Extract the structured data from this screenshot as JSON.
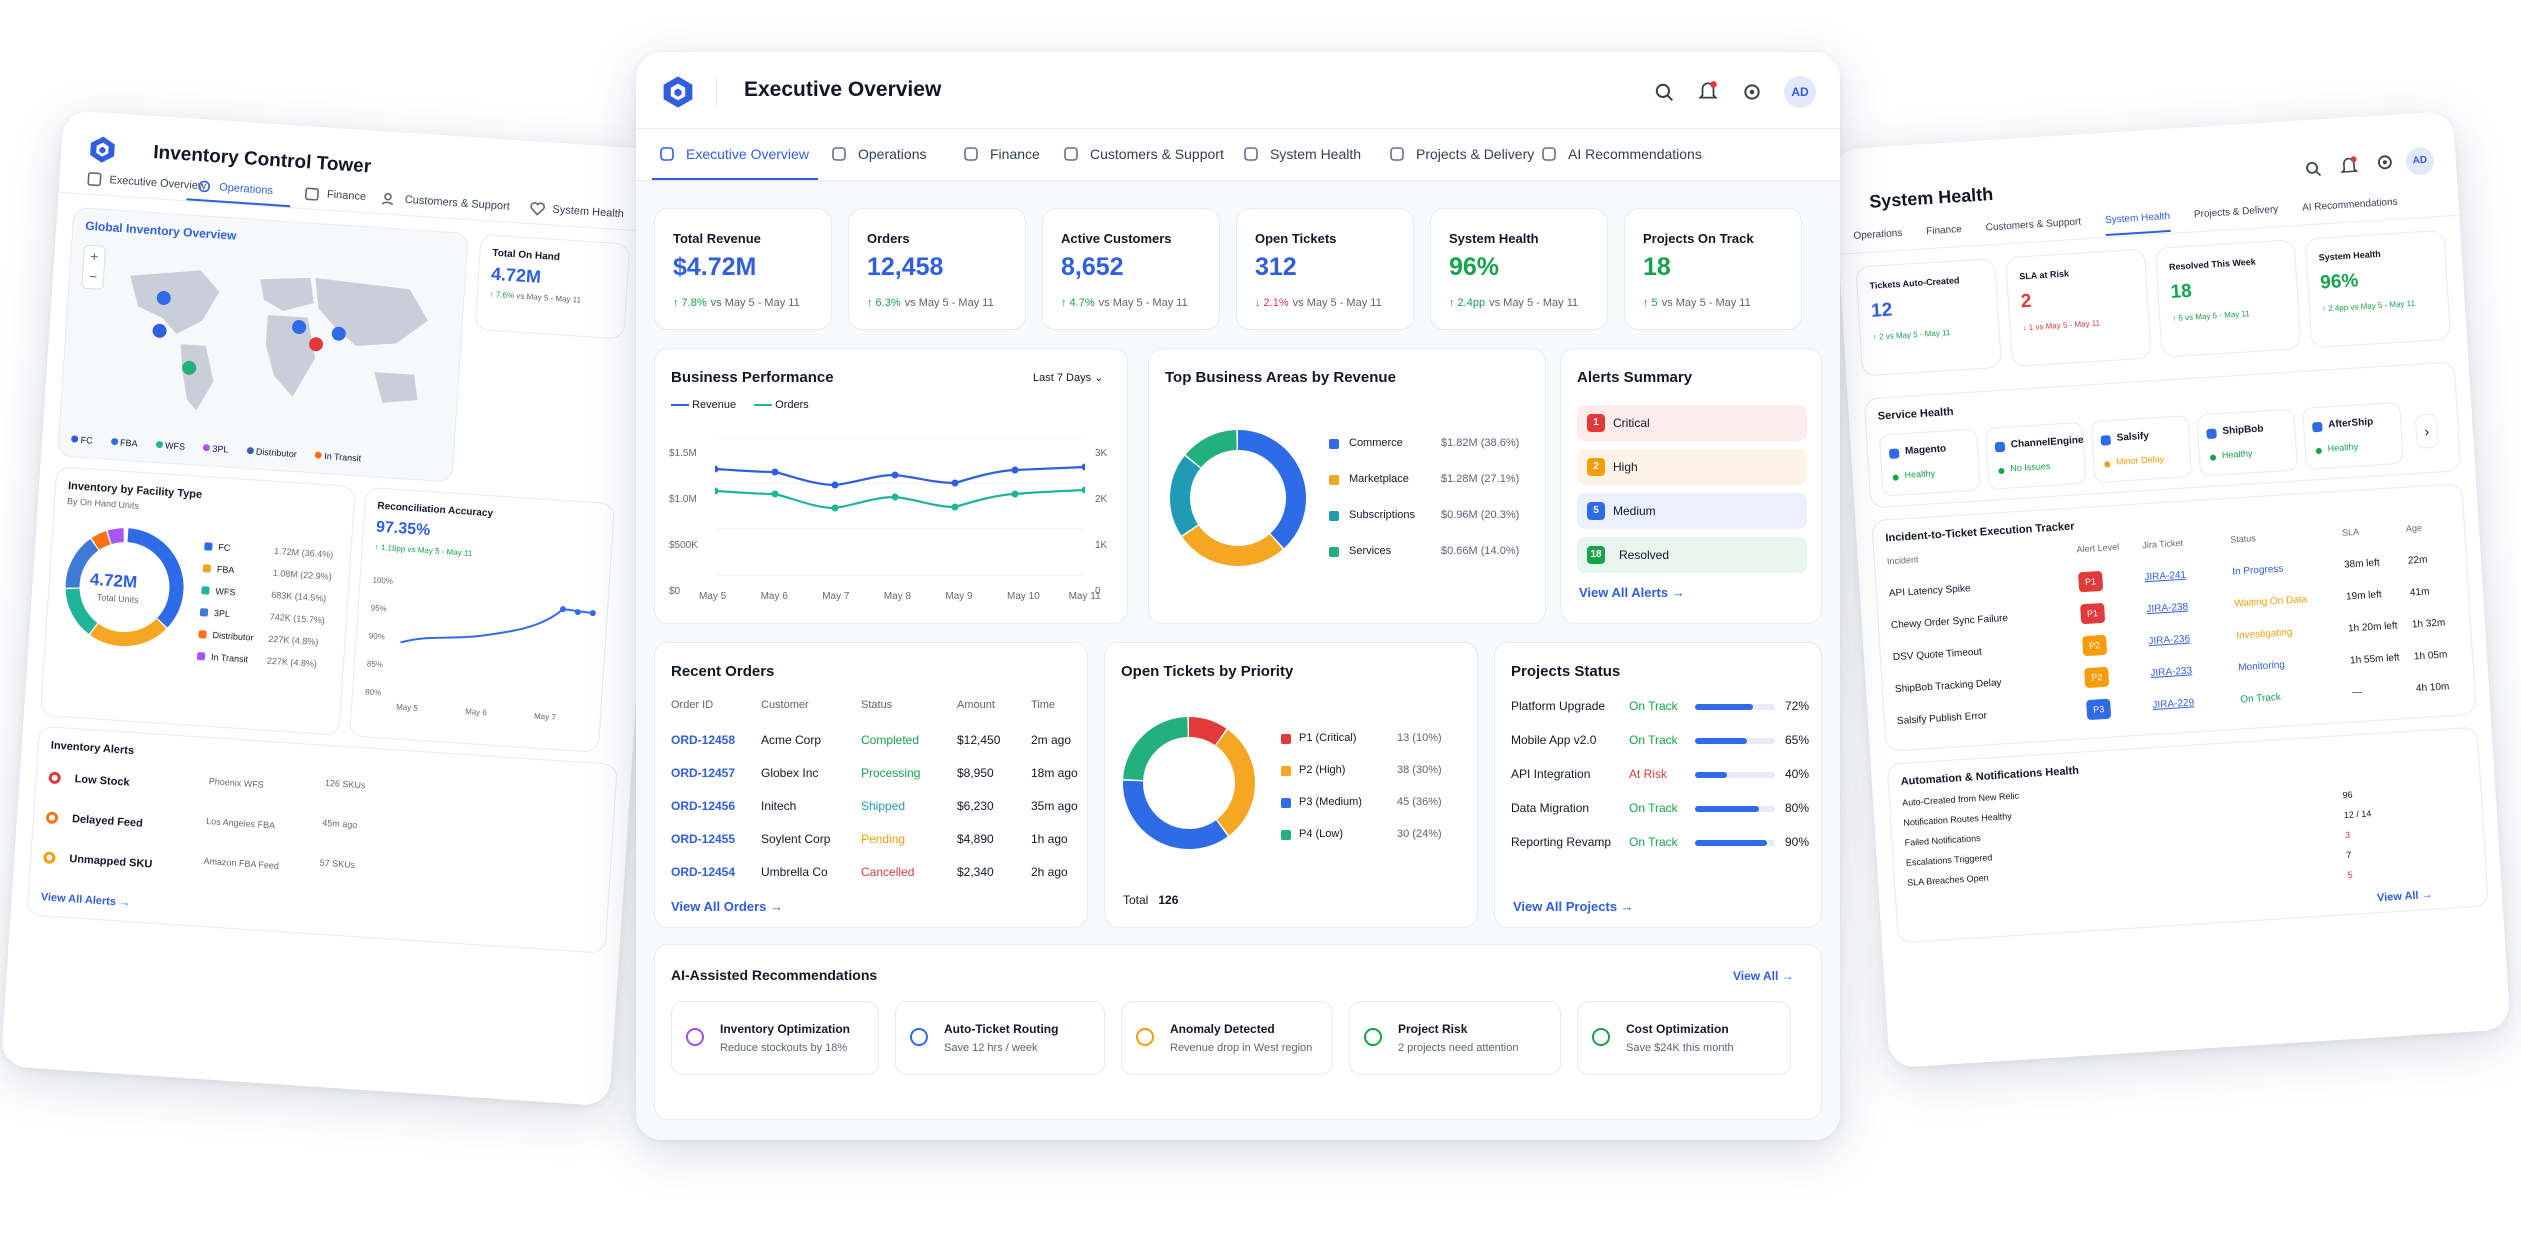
{
  "left": {
    "title": "Inventory Control Tower",
    "tabs": [
      "Executive Overview",
      "Operations",
      "Finance",
      "Customers & Support",
      "System Health"
    ],
    "map": {
      "title": "Global Inventory Overview",
      "zoom_in": "+",
      "zoom_out": "−",
      "legend": [
        "FC",
        "FBA",
        "WFS",
        "3PL",
        "Distributor",
        "In Transit"
      ]
    },
    "on_hand": {
      "label": "Total On Hand",
      "value": "4.72M",
      "delta": "↑ 7.6%",
      "period": "vs May 5 - May 11"
    },
    "facility": {
      "title": "Inventory by Facility Type",
      "subtitle": "By On Hand Units",
      "center_value": "4.72M",
      "center_label": "Total Units",
      "rows": [
        {
          "name": "FC",
          "value": "1.72M (36.4%)",
          "color": "#2f6be6"
        },
        {
          "name": "FBA",
          "value": "1.08M (22.9%)",
          "color": "#f5a623"
        },
        {
          "name": "WFS",
          "value": "683K (14.5%)",
          "color": "#1fb59a"
        },
        {
          "name": "3PL",
          "value": "742K (15.7%)",
          "color": "#3f7bd6"
        },
        {
          "name": "Distributor",
          "value": "227K (4.8%)",
          "color": "#f97316"
        },
        {
          "name": "In Transit",
          "value": "227K (4.8%)",
          "color": "#a855f7"
        }
      ]
    },
    "recon": {
      "title": "Reconciliation Accuracy",
      "value": "97.35%",
      "delta": "↑ 1.18pp vs May 5 - May 11",
      "yticks": [
        "100%",
        "95%",
        "90%",
        "85%",
        "80%"
      ],
      "xticks": [
        "May 5",
        "May 6",
        "May 7"
      ]
    },
    "alerts": {
      "title": "Inventory Alerts",
      "link": "View All Alerts →",
      "rows": [
        {
          "name": "Low Stock",
          "where": "Phoenix WFS",
          "meta": "126 SKUs"
        },
        {
          "name": "Delayed Feed",
          "where": "Los Angeles FBA",
          "meta": "45m ago"
        },
        {
          "name": "Unmapped SKU",
          "where": "Amazon FBA Feed",
          "meta": "57 SKUs"
        }
      ]
    }
  },
  "main": {
    "title": "Executive Overview",
    "avatar": "AD",
    "tabs": [
      "Executive Overview",
      "Operations",
      "Finance",
      "Customers & Support",
      "System Health",
      "Projects & Delivery",
      "AI Recommendations"
    ],
    "kpis": [
      {
        "label": "Total Revenue",
        "value": "$4.72M",
        "delta": "↑ 7.8%",
        "period": "vs May 5 - May 11",
        "dir": "up",
        "color": "blue"
      },
      {
        "label": "Orders",
        "value": "12,458",
        "delta": "↑ 6.3%",
        "period": "vs May 5 - May 11",
        "dir": "up",
        "color": "blue"
      },
      {
        "label": "Active Customers",
        "value": "8,652",
        "delta": "↑ 4.7%",
        "period": "vs May 5 - May 11",
        "dir": "up",
        "color": "blue"
      },
      {
        "label": "Open Tickets",
        "value": "312",
        "delta": "↓ 2.1%",
        "period": "vs May 5 - May 11",
        "dir": "down",
        "color": "blue"
      },
      {
        "label": "System Health",
        "value": "96%",
        "delta": "↑ 2.4pp",
        "period": "vs May 5 - May 11",
        "dir": "up",
        "color": "green"
      },
      {
        "label": "Projects On Track",
        "value": "18",
        "delta": "↑ 5",
        "period": "vs May 5 - May 11",
        "dir": "up",
        "color": "green"
      }
    ],
    "perf": {
      "title": "Business Performance",
      "range": "Last 7 Days",
      "legend": [
        "Revenue",
        "Orders"
      ],
      "yl": [
        "$1.5M",
        "$1.0M",
        "$500K",
        "$0"
      ],
      "yr": [
        "3K",
        "2K",
        "1K",
        "0"
      ],
      "xticks": [
        "May 5",
        "May 6",
        "May 7",
        "May 8",
        "May 9",
        "May 10",
        "May 11"
      ]
    },
    "areas": {
      "title": "Top Business Areas by Revenue",
      "rows": [
        {
          "name": "Commerce",
          "value": "$1.82M (38.6%)",
          "color": "#2f6be6",
          "pct": 38.6
        },
        {
          "name": "Marketplace",
          "value": "$1.28M (27.1%)",
          "color": "#f5a623",
          "pct": 27.1
        },
        {
          "name": "Subscriptions",
          "value": "$0.96M (20.3%)",
          "color": "#1f9bb5",
          "pct": 20.3
        },
        {
          "name": "Services",
          "value": "$0.66M (14.0%)",
          "color": "#22b07d",
          "pct": 14.0
        }
      ]
    },
    "alerts": {
      "title": "Alerts Summary",
      "link": "View All Alerts →",
      "rows": [
        {
          "n": "1",
          "label": "Critical",
          "bg": "#fdecec",
          "c": "#e23a3a"
        },
        {
          "n": "2",
          "label": "High",
          "bg": "#fef3e6",
          "c": "#f59e0b"
        },
        {
          "n": "5",
          "label": "Medium",
          "bg": "#eaf0fd",
          "c": "#2f6be6"
        },
        {
          "n": "18",
          "label": "Resolved",
          "bg": "#e8f7ee",
          "c": "#16a34a"
        }
      ]
    },
    "orders": {
      "title": "Recent Orders",
      "link": "View All Orders →",
      "cols": [
        "Order ID",
        "Customer",
        "Status",
        "Amount",
        "Time"
      ],
      "rows": [
        {
          "id": "ORD-12458",
          "cust": "Acme Corp",
          "status": "Completed",
          "sc": "#16a34a",
          "amt": "$12,450",
          "time": "2m ago"
        },
        {
          "id": "ORD-12457",
          "cust": "Globex Inc",
          "status": "Processing",
          "sc": "#16a34a",
          "amt": "$8,950",
          "time": "18m ago"
        },
        {
          "id": "ORD-12456",
          "cust": "Initech",
          "status": "Shipped",
          "sc": "#1f9bb5",
          "amt": "$6,230",
          "time": "35m ago"
        },
        {
          "id": "ORD-12455",
          "cust": "Soylent Corp",
          "status": "Pending",
          "sc": "#f59e0b",
          "amt": "$4,890",
          "time": "1h ago"
        },
        {
          "id": "ORD-12454",
          "cust": "Umbrella Co",
          "status": "Cancelled",
          "sc": "#e23a3a",
          "amt": "$2,340",
          "time": "2h ago"
        }
      ]
    },
    "tickets": {
      "title": "Open Tickets by Priority",
      "total_label": "Total",
      "total": "126",
      "rows": [
        {
          "name": "P1 (Critical)",
          "value": "13 (10%)",
          "color": "#e23a3a",
          "pct": 10
        },
        {
          "name": "P2 (High)",
          "value": "38 (30%)",
          "color": "#f5a623",
          "pct": 30
        },
        {
          "name": "P3 (Medium)",
          "value": "45 (36%)",
          "color": "#2f6be6",
          "pct": 36
        },
        {
          "name": "P4 (Low)",
          "value": "30 (24%)",
          "color": "#22b07d",
          "pct": 24
        }
      ]
    },
    "projects": {
      "title": "Projects Status",
      "link": "View All Projects →",
      "rows": [
        {
          "name": "Platform Upgrade",
          "status": "On Track",
          "sc": "#16a34a",
          "pct": "72%",
          "p": 72
        },
        {
          "name": "Mobile App v2.0",
          "status": "On Track",
          "sc": "#16a34a",
          "pct": "65%",
          "p": 65
        },
        {
          "name": "API Integration",
          "status": "At Risk",
          "sc": "#e23a3a",
          "pct": "40%",
          "p": 40
        },
        {
          "name": "Data Migration",
          "status": "On Track",
          "sc": "#16a34a",
          "pct": "80%",
          "p": 80
        },
        {
          "name": "Reporting Revamp",
          "status": "On Track",
          "sc": "#16a34a",
          "pct": "90%",
          "p": 90
        }
      ]
    },
    "ai": {
      "title": "AI-Assisted Recommendations",
      "link": "View All →",
      "rows": [
        {
          "title": "Inventory Optimization",
          "sub": "Reduce stockouts by 18%",
          "color": "#9b51e0"
        },
        {
          "title": "Auto-Ticket Routing",
          "sub": "Save 12 hrs / week",
          "color": "#2f6be6"
        },
        {
          "title": "Anomaly Detected",
          "sub": "Revenue drop in West region",
          "color": "#f59e0b"
        },
        {
          "title": "Project Risk",
          "sub": "2 projects need attention",
          "color": "#16a34a"
        },
        {
          "title": "Cost Optimization",
          "sub": "Save $24K this month",
          "color": "#16a34a"
        }
      ]
    }
  },
  "right": {
    "title": "System Health",
    "avatar": "AD",
    "tabs": [
      "Operations",
      "Finance",
      "Customers & Support",
      "System Health",
      "Projects & Delivery",
      "AI Recommendations"
    ],
    "kpis": [
      {
        "label": "Tickets Auto-Created",
        "value": "12",
        "delta": "↑ 2 vs May 5 - May 11",
        "vc": "#2f5fe0",
        "dc": "#16a34a"
      },
      {
        "label": "SLA at Risk",
        "value": "2",
        "delta": "↓ 1 vs May 5 - May 11",
        "vc": "#e23a3a",
        "dc": "#e23a3a"
      },
      {
        "label": "Resolved This Week",
        "value": "18",
        "delta": "↑ 5 vs May 5 - May 11",
        "vc": "#16a34a",
        "dc": "#16a34a"
      },
      {
        "label": "System Health",
        "value": "96%",
        "delta": "↑ 2.4pp vs May 5 - May 11",
        "vc": "#16a34a",
        "dc": "#16a34a"
      }
    ],
    "service": {
      "title": "Service Health",
      "next": "›",
      "rows": [
        {
          "name": "Magento",
          "status": "Healthy",
          "c": "#16a34a"
        },
        {
          "name": "ChannelEngine",
          "status": "No Issues",
          "c": "#16a34a"
        },
        {
          "name": "Salsify",
          "status": "Minor Delay",
          "c": "#f59e0b"
        },
        {
          "name": "ShipBob",
          "status": "Healthy",
          "c": "#16a34a"
        },
        {
          "name": "AfterShip",
          "status": "Healthy",
          "c": "#16a34a"
        }
      ]
    },
    "tracker": {
      "title": "Incident-to-Ticket Execution Tracker",
      "cols": [
        "Incident",
        "Alert Level",
        "Jira Ticket",
        "Status",
        "SLA",
        "Age"
      ],
      "rows": [
        {
          "inc": "API Latency Spike",
          "lvl": "P1",
          "lc": "#e23a3a",
          "jira": "JIRA-241",
          "st": "In Progress",
          "sc": "#2f5fe0",
          "sla": "38m left",
          "age": "22m"
        },
        {
          "inc": "Chewy Order Sync Failure",
          "lvl": "P1",
          "lc": "#e23a3a",
          "jira": "JIRA-238",
          "st": "Waiting On Data",
          "sc": "#f59e0b",
          "sla": "19m left",
          "age": "41m"
        },
        {
          "inc": "DSV Quote Timeout",
          "lvl": "P2",
          "lc": "#f59e0b",
          "jira": "JIRA-236",
          "st": "Investigating",
          "sc": "#f59e0b",
          "sla": "1h 20m left",
          "age": "1h 32m"
        },
        {
          "inc": "ShipBob Tracking Delay",
          "lvl": "P2",
          "lc": "#f59e0b",
          "jira": "JIRA-233",
          "st": "Monitoring",
          "sc": "#2f5fe0",
          "sla": "1h 55m left",
          "age": "1h 05m"
        },
        {
          "inc": "Salsify Publish Error",
          "lvl": "P3",
          "lc": "#2f6be6",
          "jira": "JIRA-229",
          "st": "On Track",
          "sc": "#16a34a",
          "sla": "—",
          "age": "4h 10m"
        }
      ]
    },
    "auto": {
      "title": "Automation & Notifications Health",
      "link": "View All →",
      "rows": [
        {
          "name": "Auto-Created from New Relic",
          "val": "",
          "c": "#101828"
        },
        {
          "name": "Notification Routes Healthy",
          "val": "96",
          "c": "#101828"
        },
        {
          "name": "Failed Notifications",
          "val": "12 / 14",
          "c": "#101828"
        },
        {
          "name": "Escalations Triggered",
          "val": "3",
          "c": "#e23a3a"
        },
        {
          "name": "SLA Breaches Open",
          "val": "7",
          "c": "#101828"
        },
        {
          "name": "",
          "val": "5",
          "c": "#e23a3a"
        }
      ]
    }
  }
}
